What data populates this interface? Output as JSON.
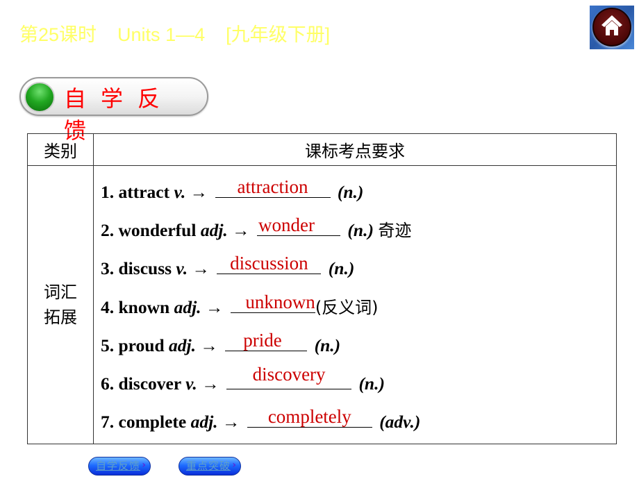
{
  "header": {
    "lesson": "第25课时",
    "units": "Units 1—4",
    "grade": "[九年级下册]",
    "header_color": "#ffff66"
  },
  "home_button": {
    "icon": "home-icon",
    "label": "Home"
  },
  "section": {
    "title": "自学反馈",
    "accent": "#ff0000"
  },
  "table": {
    "headers": [
      "类别",
      "课标考点要求"
    ],
    "category": [
      "词汇",
      "拓展"
    ],
    "items": [
      {
        "num": "1.",
        "word": "attract",
        "pos": "v.",
        "arrow": "→",
        "answer": "attraction",
        "suffix": "(n.)",
        "note": ""
      },
      {
        "num": "2.",
        "word": "wonderful",
        "pos": "adj.",
        "arrow": "→",
        "answer": "wonder",
        "suffix": "(n.)",
        "note": "奇迹"
      },
      {
        "num": "3.",
        "word": "discuss",
        "pos": "v.",
        "arrow": "→",
        "answer": "discussion",
        "suffix": "(n.)",
        "note": ""
      },
      {
        "num": "4.",
        "word": "known",
        "pos": "adj.",
        "arrow": "→",
        "answer": "unknown",
        "suffix": "",
        "note": "(反义词)"
      },
      {
        "num": "5.",
        "word": "proud",
        "pos": "adj.",
        "arrow": "→",
        "answer": "pride",
        "suffix": "(n.)",
        "note": ""
      },
      {
        "num": "6.",
        "word": "discover",
        "pos": "v.",
        "arrow": "→",
        "answer": "discovery",
        "suffix": "(n.)",
        "note": ""
      },
      {
        "num": "7.",
        "word": "complete",
        "pos": "adj.",
        "arrow": "→",
        "answer": "completely",
        "suffix": "(adv.)",
        "note": ""
      }
    ],
    "answer_color": "#cc0000"
  },
  "nav": {
    "buttons": [
      {
        "label": "自学反馈",
        "icon": "chevron-right-icon"
      },
      {
        "label": "重点突破",
        "icon": "chevron-right-icon"
      }
    ],
    "arrow_glyph": "›"
  }
}
